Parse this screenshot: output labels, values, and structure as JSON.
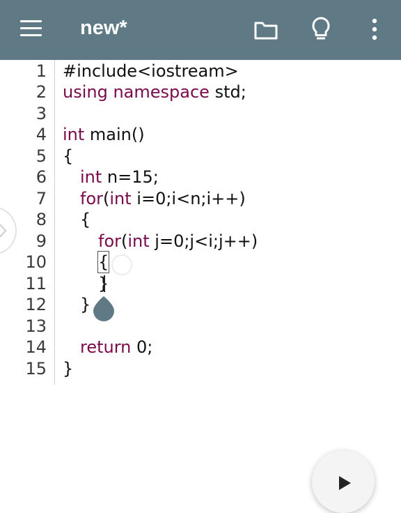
{
  "app_bar": {
    "title": "new*",
    "menu_icon": "hamburger-menu-icon",
    "actions": [
      {
        "name": "open-folder",
        "icon": "folder-icon"
      },
      {
        "name": "tips",
        "icon": "lightbulb-icon"
      },
      {
        "name": "more-options",
        "icon": "more-vert-icon"
      }
    ],
    "color": "#5f7985"
  },
  "editor": {
    "lines": [
      {
        "num": "1",
        "code": "#include<iostream>"
      },
      {
        "num": "2",
        "code": "using namespace std;"
      },
      {
        "num": "3",
        "code": ""
      },
      {
        "num": "4",
        "code": "int main()"
      },
      {
        "num": "5",
        "code": "{"
      },
      {
        "num": "6",
        "code": "int n=15;"
      },
      {
        "num": "7",
        "code": "for(int i=0;i<n;i++)"
      },
      {
        "num": "8",
        "code": "{"
      },
      {
        "num": "9",
        "code": "for(int j=0;j<i;j++)"
      },
      {
        "num": "10",
        "code": "{"
      },
      {
        "num": "11",
        "code": "}"
      },
      {
        "num": "12",
        "code": "}"
      },
      {
        "num": "13",
        "code": ""
      },
      {
        "num": "14",
        "code": "return 0;"
      },
      {
        "num": "15",
        "code": "}"
      }
    ],
    "cursor_line": 11,
    "keyword_color": "#7a0a4a",
    "preprocessor_color": "#8a0e0e"
  },
  "fab": {
    "icon": "play-icon"
  },
  "side_handle": {
    "icon": "chevron-right-icon"
  }
}
